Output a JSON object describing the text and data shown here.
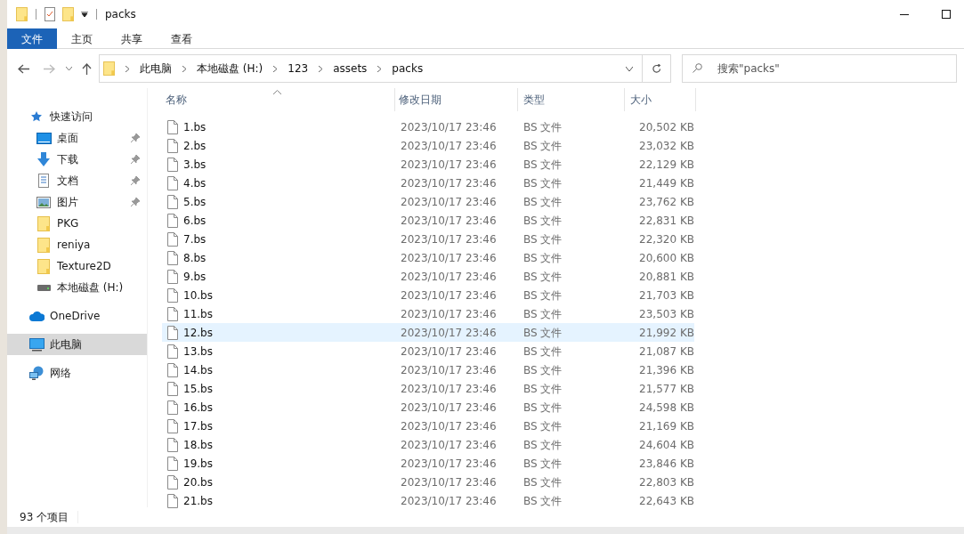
{
  "window": {
    "title": "packs"
  },
  "ribbon_tabs": [
    {
      "label": "文件",
      "selected": true
    },
    {
      "label": "主页",
      "selected": false
    },
    {
      "label": "共享",
      "selected": false
    },
    {
      "label": "查看",
      "selected": false
    }
  ],
  "address": {
    "crumbs": [
      "此电脑",
      "本地磁盘 (H:)",
      "123",
      "assets",
      "packs"
    ]
  },
  "search": {
    "placeholder": "搜索\"packs\""
  },
  "sidebar": {
    "items": [
      {
        "label": "快速访问",
        "kind": "quick",
        "selected": false,
        "children": [
          {
            "label": "桌面",
            "kind": "desktop",
            "pinned": true,
            "selected": false
          },
          {
            "label": "下载",
            "kind": "download",
            "pinned": true,
            "selected": false
          },
          {
            "label": "文档",
            "kind": "docs",
            "pinned": true,
            "selected": false
          },
          {
            "label": "图片",
            "kind": "pictures",
            "pinned": true,
            "selected": false
          },
          {
            "label": "PKG",
            "kind": "folder",
            "pinned": false,
            "selected": false
          },
          {
            "label": "reniya",
            "kind": "folder",
            "pinned": false,
            "selected": false
          },
          {
            "label": "Texture2D",
            "kind": "folder",
            "pinned": false,
            "selected": false
          },
          {
            "label": "本地磁盘 (H:)",
            "kind": "drive",
            "pinned": false,
            "selected": false
          }
        ]
      },
      {
        "label": "OneDrive",
        "kind": "onedrive",
        "selected": false
      },
      {
        "label": "此电脑",
        "kind": "pc",
        "selected": true
      },
      {
        "label": "网络",
        "kind": "network",
        "selected": false
      }
    ]
  },
  "table": {
    "columns": [
      "名称",
      "修改日期",
      "类型",
      "大小"
    ],
    "rows": [
      {
        "name": "1.bs",
        "date": "2023/10/17 23:46",
        "type": "BS 文件",
        "size": "20,502 KB",
        "selected": false
      },
      {
        "name": "2.bs",
        "date": "2023/10/17 23:46",
        "type": "BS 文件",
        "size": "23,032 KB",
        "selected": false
      },
      {
        "name": "3.bs",
        "date": "2023/10/17 23:46",
        "type": "BS 文件",
        "size": "22,129 KB",
        "selected": false
      },
      {
        "name": "4.bs",
        "date": "2023/10/17 23:46",
        "type": "BS 文件",
        "size": "21,449 KB",
        "selected": false
      },
      {
        "name": "5.bs",
        "date": "2023/10/17 23:46",
        "type": "BS 文件",
        "size": "23,762 KB",
        "selected": false
      },
      {
        "name": "6.bs",
        "date": "2023/10/17 23:46",
        "type": "BS 文件",
        "size": "22,831 KB",
        "selected": false
      },
      {
        "name": "7.bs",
        "date": "2023/10/17 23:46",
        "type": "BS 文件",
        "size": "22,320 KB",
        "selected": false
      },
      {
        "name": "8.bs",
        "date": "2023/10/17 23:46",
        "type": "BS 文件",
        "size": "20,600 KB",
        "selected": false
      },
      {
        "name": "9.bs",
        "date": "2023/10/17 23:46",
        "type": "BS 文件",
        "size": "20,881 KB",
        "selected": false
      },
      {
        "name": "10.bs",
        "date": "2023/10/17 23:46",
        "type": "BS 文件",
        "size": "21,703 KB",
        "selected": false
      },
      {
        "name": "11.bs",
        "date": "2023/10/17 23:46",
        "type": "BS 文件",
        "size": "23,503 KB",
        "selected": false
      },
      {
        "name": "12.bs",
        "date": "2023/10/17 23:46",
        "type": "BS 文件",
        "size": "21,992 KB",
        "selected": true
      },
      {
        "name": "13.bs",
        "date": "2023/10/17 23:46",
        "type": "BS 文件",
        "size": "21,087 KB",
        "selected": false
      },
      {
        "name": "14.bs",
        "date": "2023/10/17 23:46",
        "type": "BS 文件",
        "size": "21,396 KB",
        "selected": false
      },
      {
        "name": "15.bs",
        "date": "2023/10/17 23:46",
        "type": "BS 文件",
        "size": "21,577 KB",
        "selected": false
      },
      {
        "name": "16.bs",
        "date": "2023/10/17 23:46",
        "type": "BS 文件",
        "size": "24,598 KB",
        "selected": false
      },
      {
        "name": "17.bs",
        "date": "2023/10/17 23:46",
        "type": "BS 文件",
        "size": "21,169 KB",
        "selected": false
      },
      {
        "name": "18.bs",
        "date": "2023/10/17 23:46",
        "type": "BS 文件",
        "size": "24,604 KB",
        "selected": false
      },
      {
        "name": "19.bs",
        "date": "2023/10/17 23:46",
        "type": "BS 文件",
        "size": "23,846 KB",
        "selected": false
      },
      {
        "name": "20.bs",
        "date": "2023/10/17 23:46",
        "type": "BS 文件",
        "size": "22,803 KB",
        "selected": false
      },
      {
        "name": "21.bs",
        "date": "2023/10/17 23:46",
        "type": "BS 文件",
        "size": "22,643 KB",
        "selected": false
      }
    ]
  },
  "status_bar": {
    "count": "93 个项目"
  }
}
